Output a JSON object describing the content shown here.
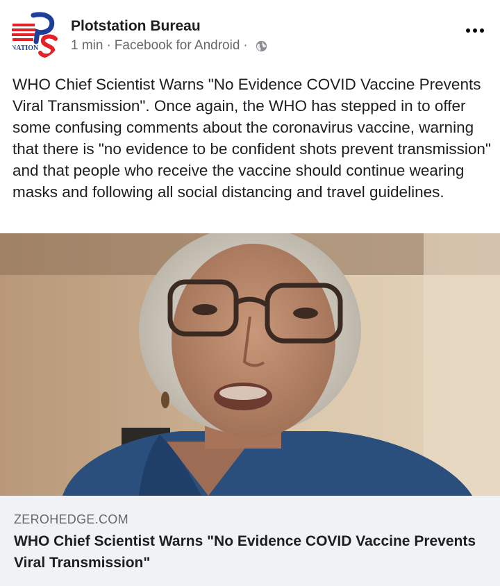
{
  "post": {
    "page_name": "Plotstation Bureau",
    "time": "1 min",
    "via": "Facebook for Android",
    "separator": "·",
    "privacy_icon": "globe-icon",
    "menu_icon": "more-options-icon",
    "avatar_logo_text": "NATION",
    "text": "WHO Chief Scientist Warns \"No Evidence COVID Vaccine Prevents Viral Transmission\". Once again, the WHO has stepped in to offer some confusing comments about the coronavirus vaccine, warning that there is \"no evidence to be confident shots prevent transmission\" and that people who receive the vaccine should continue wearing masks and following all social distancing and travel guidelines."
  },
  "link": {
    "domain": "ZEROHEDGE.COM",
    "title": "WHO Chief Scientist Warns \"No Evidence COVID Vaccine Prevents Viral Transmission\""
  },
  "colors": {
    "text": "#1c1e21",
    "secondary": "#65676b",
    "preview_bg": "#f0f2f5",
    "logo_red": "#e32228",
    "logo_blue": "#1d3f9a"
  }
}
